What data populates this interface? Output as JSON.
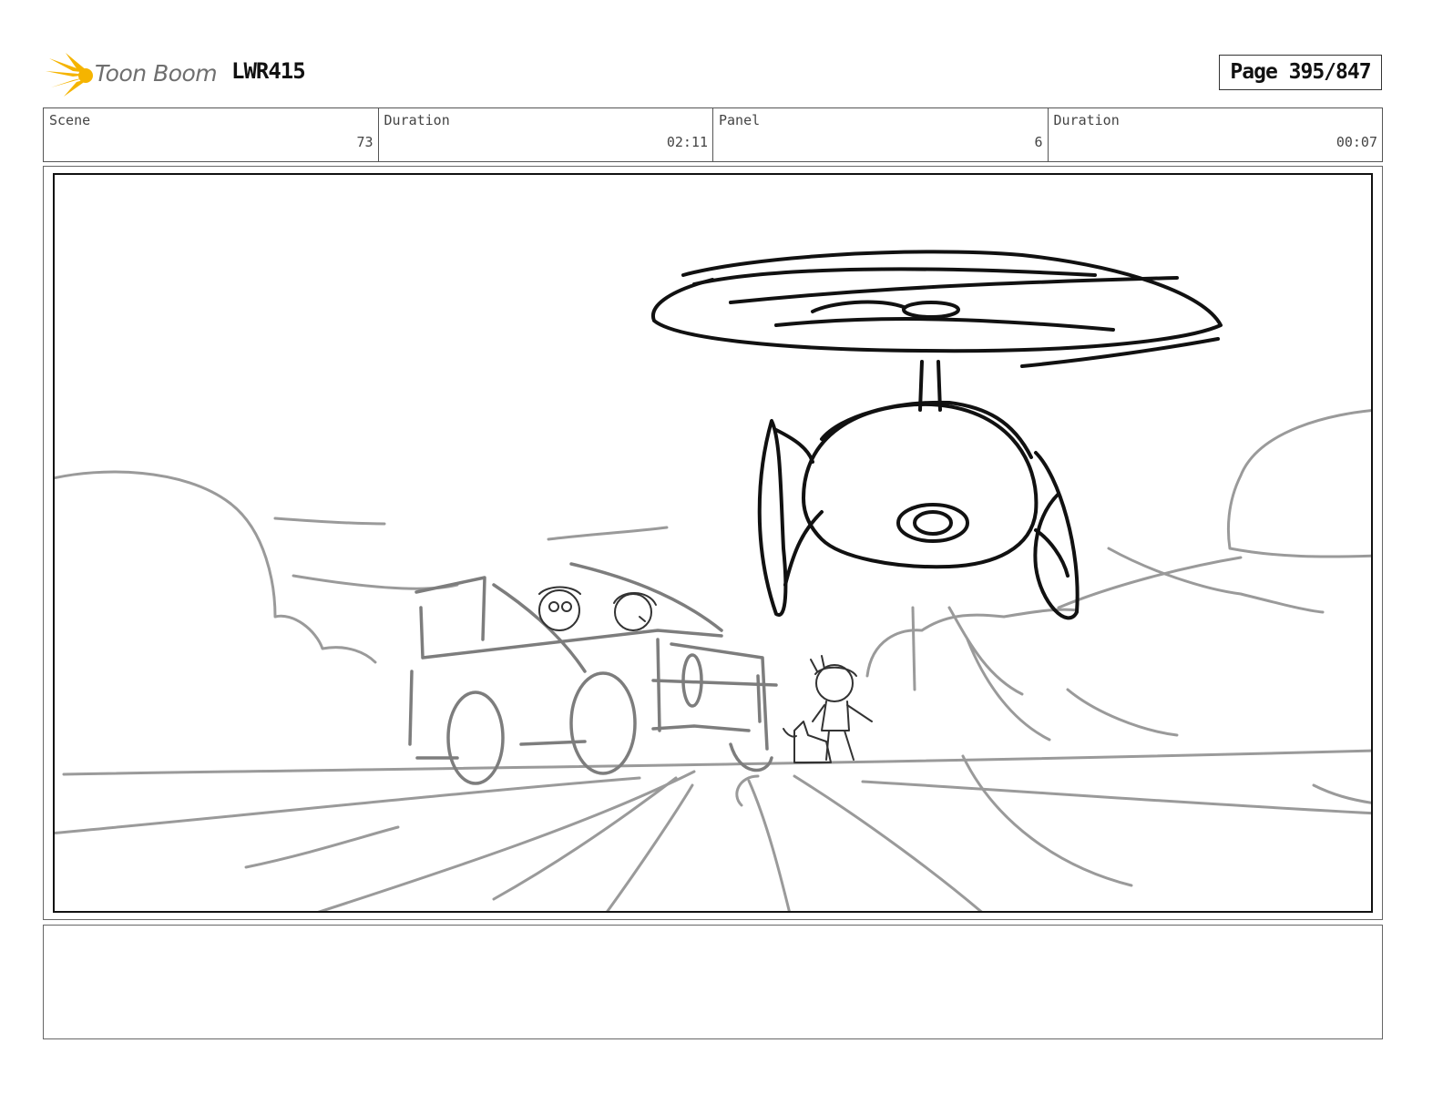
{
  "header": {
    "logo_text": "Toon Boom",
    "project_code": "LWR415",
    "page_label": "Page 395/847"
  },
  "info": {
    "scene_label": "Scene",
    "scene_value": "73",
    "scene_duration_label": "Duration",
    "scene_duration_value": "02:11",
    "panel_label": "Panel",
    "panel_value": "6",
    "panel_duration_label": "Duration",
    "panel_duration_value": "00:07"
  },
  "notes": {
    "text": ""
  },
  "colors": {
    "logo_accent": "#f5b400",
    "sketch_dark": "#111111",
    "sketch_gray": "#9a9a9a"
  }
}
